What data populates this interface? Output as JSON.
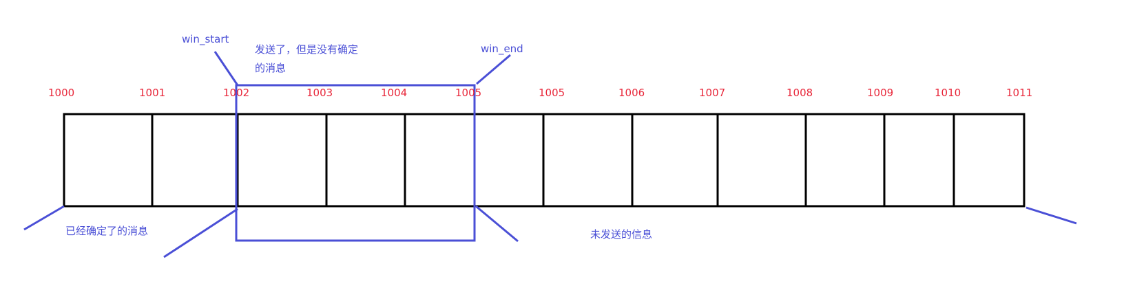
{
  "sequence_numbers": [
    "1000",
    "1001",
    "1002",
    "1003",
    "1004",
    "1005",
    "1005",
    "1006",
    "1007",
    "1008",
    "1009",
    "1010",
    "1011"
  ],
  "annotations": {
    "win_start": "win_start",
    "win_end": "win_end",
    "sent_unconfirmed_line1": "发送了，但是没有确定",
    "sent_unconfirmed_line2": "的消息",
    "confirmed": "已经确定了的消息",
    "unsent": "未发送的信息"
  },
  "colors": {
    "number": "#e8273a",
    "annotation": "#4a4fd6",
    "box": "#000000"
  }
}
